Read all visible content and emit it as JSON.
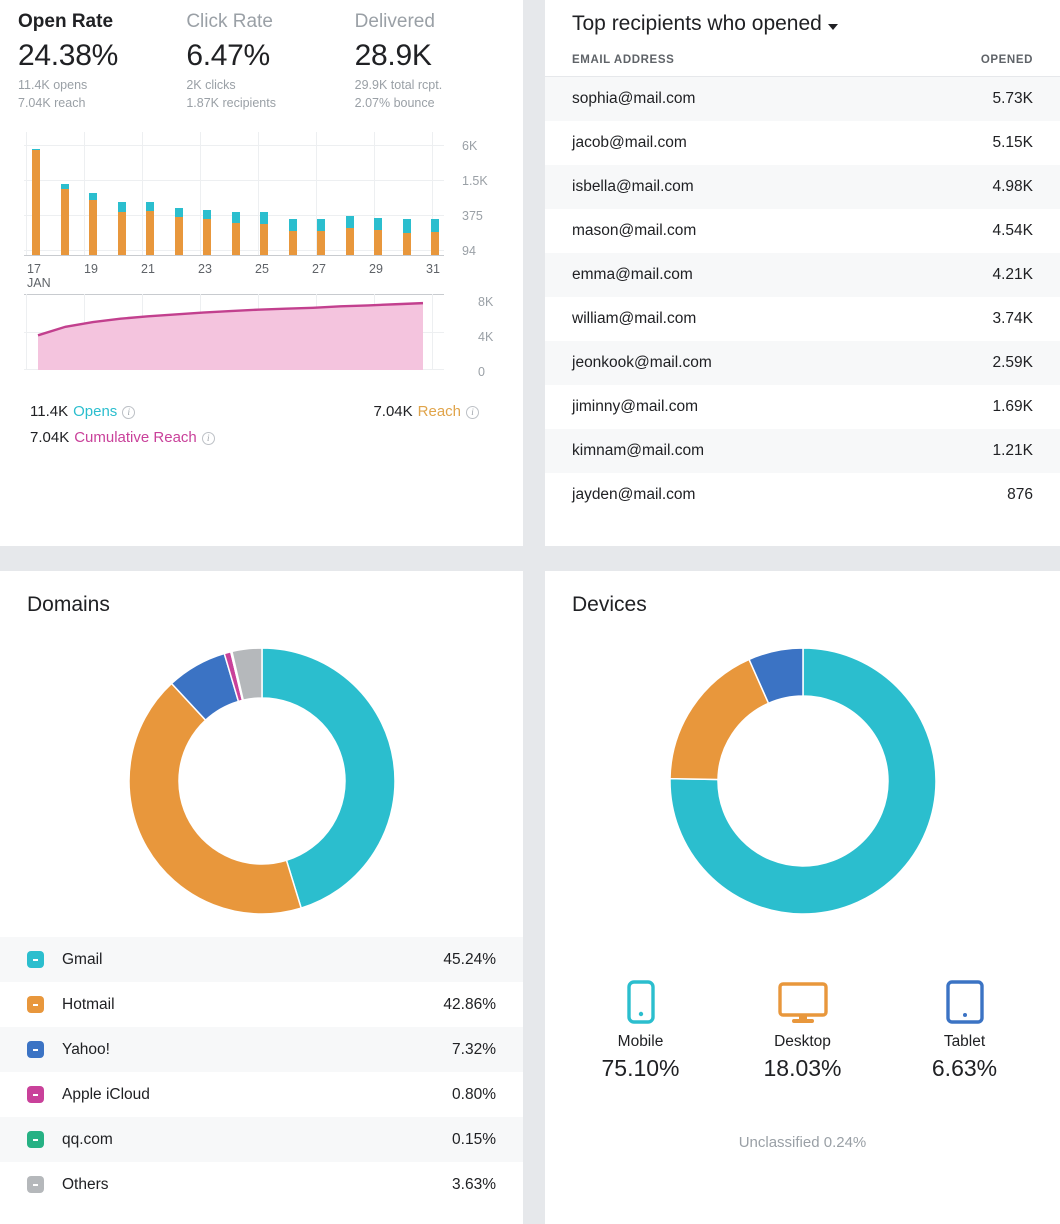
{
  "kpis": [
    {
      "label": "Open Rate",
      "value": "24.38%",
      "sub1": "11.4K opens",
      "sub2": "7.04K reach"
    },
    {
      "label": "Click Rate",
      "value": "6.47%",
      "sub1": "2K clicks",
      "sub2": "1.87K recipients"
    },
    {
      "label": "Delivered",
      "value": "28.9K",
      "sub1": "29.9K total rcpt.",
      "sub2": "2.07% bounce"
    }
  ],
  "legend": {
    "opens_value": "11.4K",
    "opens_label": "Opens",
    "reach_value": "7.04K",
    "reach_label": "Reach",
    "cumulative_value": "7.04K",
    "cumulative_label": "Cumulative Reach",
    "info_glyph": "i"
  },
  "recipients": {
    "title": "Top recipients who opened",
    "columns": {
      "email": "EMAIL ADDRESS",
      "opened": "OPENED"
    },
    "rows": [
      {
        "email": "sophia@mail.com",
        "opened": "5.73K"
      },
      {
        "email": "jacob@mail.com",
        "opened": "5.15K"
      },
      {
        "email": "isbella@mail.com",
        "opened": "4.98K"
      },
      {
        "email": "mason@mail.com",
        "opened": "4.54K"
      },
      {
        "email": "emma@mail.com",
        "opened": "4.21K"
      },
      {
        "email": "william@mail.com",
        "opened": "3.74K"
      },
      {
        "email": "jeonkook@mail.com",
        "opened": "2.59K"
      },
      {
        "email": "jiminny@mail.com",
        "opened": "1.69K"
      },
      {
        "email": "kimnam@mail.com",
        "opened": "1.21K"
      },
      {
        "email": "jayden@mail.com",
        "opened": "876"
      }
    ]
  },
  "domains": {
    "title": "Domains"
  },
  "devices": {
    "title": "Devices",
    "items": [
      {
        "name": "Mobile",
        "pct": "75.10%",
        "icon": "mobile-phone-icon",
        "color": "#2BBECE"
      },
      {
        "name": "Desktop",
        "pct": "18.03%",
        "icon": "desktop-monitor-icon",
        "color": "#E8973C"
      },
      {
        "name": "Tablet",
        "pct": "6.63%",
        "icon": "tablet-icon",
        "color": "#3B73C4"
      }
    ],
    "unclassified": "Unclassified 0.24%"
  },
  "colors": {
    "teal": "#2BBECE",
    "orange": "#E8973C",
    "blue": "#3B73C4",
    "magenta": "#C9419A",
    "green": "#26B184",
    "gray": "#B5B8BB",
    "pink_line": "#C2408E",
    "pink_fill": "#F4C4DE",
    "card_bg": "#FFFFFF",
    "page_bg": "#E6E8EB"
  },
  "chart_data": [
    {
      "type": "bar",
      "title": "",
      "stacked": true,
      "xlabel": "",
      "ylabel": "",
      "categories": [
        "17",
        "18",
        "19",
        "20",
        "21",
        "22",
        "23",
        "24",
        "25",
        "26",
        "27",
        "28",
        "29",
        "30",
        "31"
      ],
      "month_label": "JAN",
      "xtick_labels": [
        "17",
        "19",
        "21",
        "23",
        "25",
        "27",
        "29",
        "31"
      ],
      "ytick_labels": [
        "6K",
        "1.5K",
        "375",
        "94"
      ],
      "yscale": "log",
      "series": [
        {
          "name": "Opens",
          "color": "#E8973C",
          "values": [
            5200,
            900,
            560,
            330,
            340,
            260,
            240,
            200,
            195,
            140,
            138,
            158,
            148,
            130,
            132
          ]
        },
        {
          "name": "Reach",
          "color": "#2BBECE",
          "values": [
            140,
            240,
            190,
            175,
            165,
            130,
            120,
            130,
            125,
            100,
            98,
            110,
            105,
            105,
            105
          ]
        }
      ]
    },
    {
      "type": "area",
      "title": "",
      "name": "Cumulative Reach",
      "line_color": "#C2408E",
      "fill_color": "#F4C4DE",
      "ytick_labels": [
        "8K",
        "4K",
        "0"
      ],
      "ylim": [
        0,
        8000
      ],
      "x": [
        "17",
        "18",
        "19",
        "20",
        "21",
        "22",
        "23",
        "24",
        "25",
        "26",
        "27",
        "28",
        "29",
        "30",
        "31"
      ],
      "values": [
        3650,
        4550,
        5050,
        5400,
        5650,
        5850,
        6050,
        6200,
        6350,
        6450,
        6550,
        6700,
        6800,
        6920,
        7040
      ]
    },
    {
      "type": "pie",
      "title": "Domains",
      "donut": true,
      "labels": [
        "Gmail",
        "Hotmail",
        "Yahoo!",
        "Apple iCloud",
        "qq.com",
        "Others"
      ],
      "values": [
        45.24,
        42.86,
        7.32,
        0.8,
        0.15,
        3.63
      ],
      "display_values": [
        "45.24%",
        "42.86%",
        "7.32%",
        "0.80%",
        "0.15%",
        "3.63%"
      ],
      "colors": [
        "#2BBECE",
        "#E8973C",
        "#3B73C4",
        "#C9419A",
        "#26B184",
        "#B5B8BB"
      ]
    },
    {
      "type": "pie",
      "title": "Devices",
      "donut": true,
      "labels": [
        "Mobile",
        "Desktop",
        "Tablet"
      ],
      "values": [
        75.1,
        18.03,
        6.63
      ],
      "display_values": [
        "75.10%",
        "18.03%",
        "6.63%"
      ],
      "colors": [
        "#2BBECE",
        "#E8973C",
        "#3B73C4"
      ]
    }
  ]
}
